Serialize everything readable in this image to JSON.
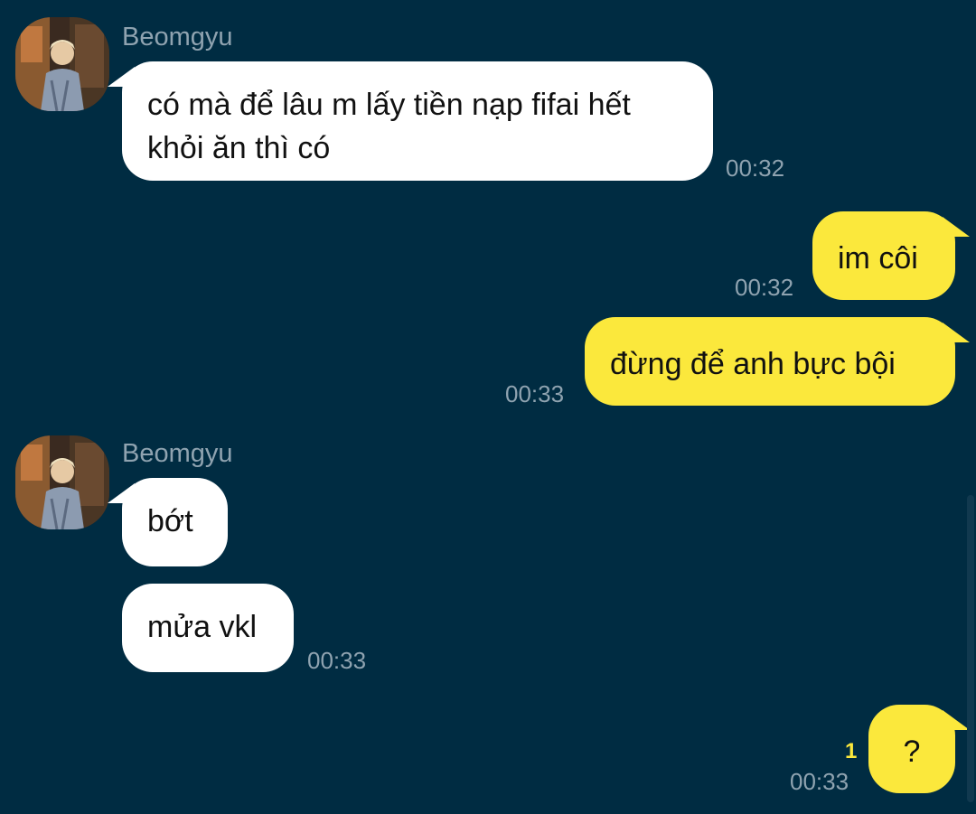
{
  "contact": {
    "name": "Beomgyu",
    "avatar_icon": "profile-photo"
  },
  "colors": {
    "background": "#002c42",
    "incoming_bubble": "#ffffff",
    "outgoing_bubble": "#fbe83c",
    "timestamp": "#8fa3b0",
    "unread_badge": "#fbe83c"
  },
  "messages": [
    {
      "direction": "incoming",
      "text": "có mà để lâu m lấy tiền nạp fifai hết\nkhỏi ăn thì có",
      "time": "00:32"
    },
    {
      "direction": "outgoing",
      "text": "im côi",
      "time": "00:32"
    },
    {
      "direction": "outgoing",
      "text": "đừng để anh bực bội",
      "time": "00:33"
    },
    {
      "direction": "incoming",
      "text": "bớt",
      "time": ""
    },
    {
      "direction": "incoming",
      "text": "mửa vkl",
      "time": "00:33"
    },
    {
      "direction": "outgoing",
      "text": "?",
      "time": "00:33",
      "unread_count": "1"
    }
  ]
}
